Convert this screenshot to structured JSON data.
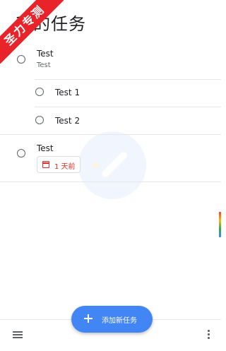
{
  "header": {
    "title": "我的任务"
  },
  "tasks": [
    {
      "title": "Test",
      "notes": "Test"
    },
    {
      "title": "Test 1"
    },
    {
      "title": "Test 2"
    },
    {
      "title": "Test",
      "due": "1 天前"
    }
  ],
  "fab": {
    "label": "添加新任务",
    "icon": "plus-icon"
  },
  "bottom_bar": {
    "left_icon": "menu-icon",
    "right_icon": "more-vert-icon"
  },
  "ribbon": {
    "text": "圣力专测"
  },
  "colors": {
    "accent": "#4285f4",
    "overdue": "#d93025",
    "ribbon": "#e8232a"
  }
}
